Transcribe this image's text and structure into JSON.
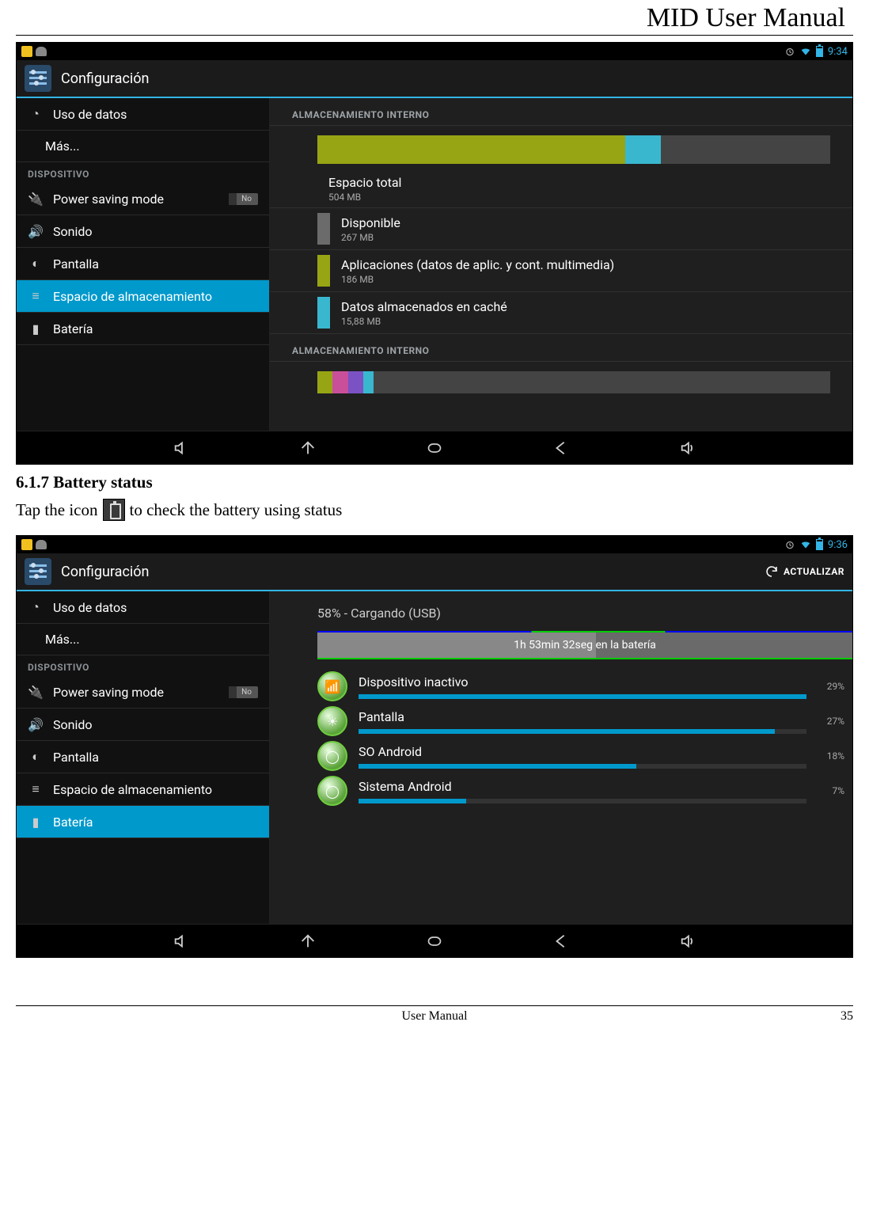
{
  "doc": {
    "title": "MID User Manual",
    "section_heading": "6.1.7 Battery status",
    "body_before": "Tap the icon",
    "body_after": "to check the battery using status",
    "footer_center": "User Manual",
    "page_number": "35"
  },
  "shot1": {
    "statusbar_time": "9:34",
    "titlebar": "Configuración",
    "sidebar": {
      "items": [
        {
          "label": "Uso de datos",
          "icon": "data"
        },
        {
          "label": "Más...",
          "icon": ""
        }
      ],
      "section_header": "DISPOSITIVO",
      "items2": [
        {
          "label": "Power saving mode",
          "icon": "power",
          "toggle": "No"
        },
        {
          "label": "Sonido",
          "icon": "sound"
        },
        {
          "label": "Pantalla",
          "icon": "display"
        },
        {
          "label": "Espacio de almacenamiento",
          "icon": "storage",
          "selected": true
        },
        {
          "label": "Batería",
          "icon": "battery"
        }
      ]
    },
    "detail": {
      "header1": "ALMACENAMIENTO INTERNO",
      "bar1_segments": [
        {
          "color": "#97a515",
          "width": 60
        },
        {
          "color": "#39b7cf",
          "width": 7
        }
      ],
      "rows": [
        {
          "label": "Espacio total",
          "value": "504 MB",
          "swatch": null
        },
        {
          "label": "Disponible",
          "value": "267 MB",
          "swatch": "#6b6b6b"
        },
        {
          "label": "Aplicaciones (datos de aplic. y cont. multimedia)",
          "value": "186 MB",
          "swatch": "#97a515"
        },
        {
          "label": "Datos almacenados en caché",
          "value": "15,88 MB",
          "swatch": "#39b7cf"
        }
      ],
      "header2": "ALMACENAMIENTO INTERNO",
      "bar2_segments": [
        {
          "color": "#97a515",
          "width": 3
        },
        {
          "color": "#c94f9b",
          "width": 3
        },
        {
          "color": "#7a52c4",
          "width": 3
        },
        {
          "color": "#39b7cf",
          "width": 2
        }
      ]
    }
  },
  "shot2": {
    "statusbar_time": "9:36",
    "titlebar": "Configuración",
    "refresh_label": "ACTUALIZAR",
    "sidebar": {
      "items": [
        {
          "label": "Uso de datos",
          "icon": "data"
        },
        {
          "label": "Más...",
          "icon": ""
        }
      ],
      "section_header": "DISPOSITIVO",
      "items2": [
        {
          "label": "Power saving mode",
          "icon": "power",
          "toggle": "No"
        },
        {
          "label": "Sonido",
          "icon": "sound"
        },
        {
          "label": "Pantalla",
          "icon": "display"
        },
        {
          "label": "Espacio de almacenamiento",
          "icon": "storage"
        },
        {
          "label": "Batería",
          "icon": "battery",
          "selected": true
        }
      ]
    },
    "detail": {
      "status_text": "58% - Cargando (USB)",
      "chart_label": "1h 53min 32seg en la batería",
      "items": [
        {
          "label": "Dispositivo inactivo",
          "pct": "29%",
          "bar": 100,
          "icon": "signal"
        },
        {
          "label": "Pantalla",
          "pct": "27%",
          "bar": 93,
          "icon": "display"
        },
        {
          "label": "SO Android",
          "pct": "18%",
          "bar": 62,
          "icon": "android"
        },
        {
          "label": "Sistema Android",
          "pct": "7%",
          "bar": 24,
          "icon": "android"
        }
      ]
    }
  },
  "chart_data": [
    {
      "type": "bar",
      "title": "Almacenamiento interno usage",
      "categories": [
        "Aplicaciones",
        "Datos en caché",
        "Disponible"
      ],
      "values": [
        186,
        15.88,
        267
      ],
      "total": 504,
      "unit": "MB"
    },
    {
      "type": "bar",
      "title": "Battery usage by component",
      "categories": [
        "Dispositivo inactivo",
        "Pantalla",
        "SO Android",
        "Sistema Android"
      ],
      "values": [
        29,
        27,
        18,
        7
      ],
      "unit": "%",
      "ylim": [
        0,
        100
      ],
      "annotation": "58% - Cargando (USB), 1h 53min 32seg en la batería"
    }
  ]
}
